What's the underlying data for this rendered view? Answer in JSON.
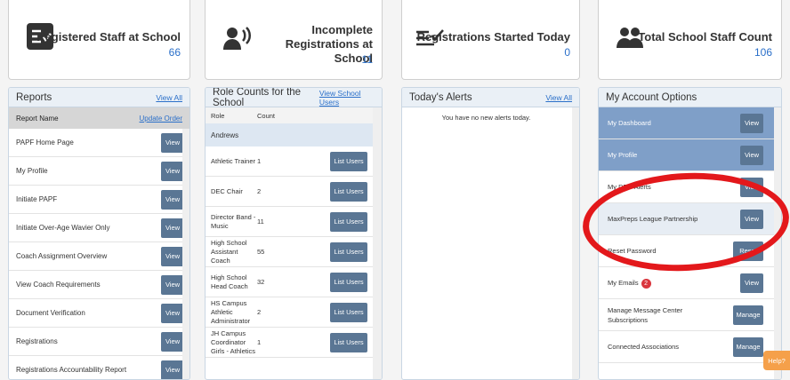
{
  "stats": [
    {
      "label": "Registered Staff at School",
      "value": "66",
      "icon": "checklist-icon"
    },
    {
      "label": "Incomplete Registrations at School",
      "value": "11",
      "icon": "user-sound-icon"
    },
    {
      "label": "Registrations Started Today",
      "value": "0",
      "icon": "list-check-icon"
    },
    {
      "label": "Total School Staff Count",
      "value": "106",
      "icon": "group-icon"
    }
  ],
  "reports": {
    "title": "Reports",
    "view_all": "View All",
    "col_name": "Report Name",
    "update_order": "Update Order",
    "button": "View",
    "items": [
      "PAPF Home Page",
      "My Profile",
      "Initiate PAPF",
      "Initiate Over-Age Wavier Only",
      "Coach Assignment Overview",
      "View Coach Requirements",
      "Document Verification",
      "Registrations",
      "Registrations Accountability Report"
    ]
  },
  "roles": {
    "title": "Role Counts for the School",
    "view_users": "View School Users",
    "col_role": "Role",
    "col_count": "Count",
    "group": "Andrews",
    "button": "List Users",
    "items": [
      {
        "role": "Athletic Trainer",
        "count": "1"
      },
      {
        "role": "DEC Chair",
        "count": "2"
      },
      {
        "role": "Director Band - Music",
        "count": "11"
      },
      {
        "role": "High School Assistant Coach",
        "count": "55"
      },
      {
        "role": "High School Head Coach",
        "count": "32"
      },
      {
        "role": "HS Campus Athletic Administrator",
        "count": "2"
      },
      {
        "role": "JH Campus Coordinator Girls - Athletics",
        "count": "1"
      }
    ]
  },
  "alerts": {
    "title": "Today's Alerts",
    "view_all": "View All",
    "empty": "You have no new alerts today."
  },
  "account": {
    "title": "My Account Options",
    "items": [
      {
        "label": "My Dashboard",
        "button": "View"
      },
      {
        "label": "My Profile",
        "button": "View"
      },
      {
        "label": "My DEC Alerts",
        "button": "View"
      },
      {
        "label": "MaxPreps League Partnership",
        "button": "View"
      },
      {
        "label": "Reset Password",
        "button": "Reset"
      },
      {
        "label": "My Emails",
        "button": "View",
        "badge": "2"
      },
      {
        "label": "Manage Message Center Subscriptions",
        "button": "Manage"
      },
      {
        "label": "Connected Associations",
        "button": "Manage"
      }
    ]
  },
  "help": "Help?"
}
